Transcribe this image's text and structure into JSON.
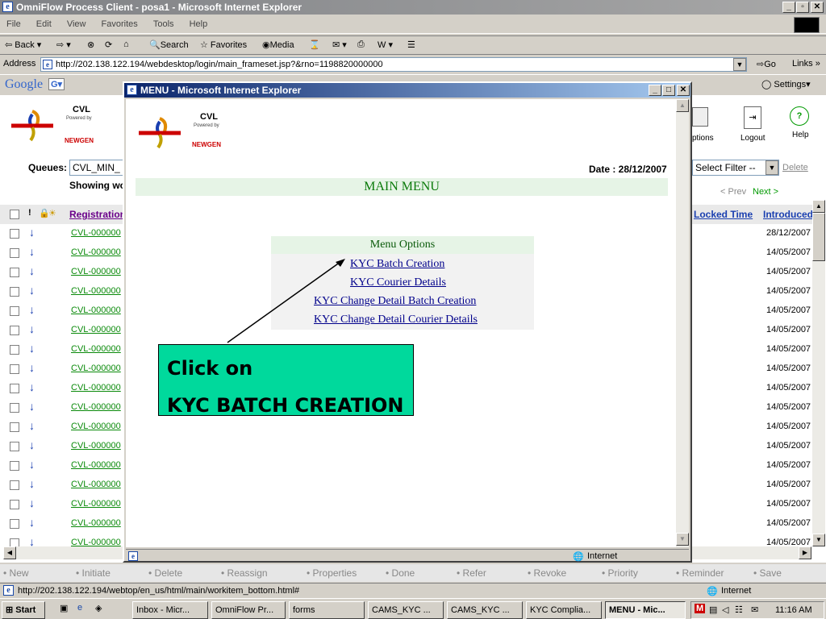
{
  "window": {
    "title": "OmniFlow Process Client - posa1 - Microsoft Internet Explorer"
  },
  "menubar": [
    "File",
    "Edit",
    "View",
    "Favorites",
    "Tools",
    "Help"
  ],
  "toolbar": {
    "back": "Back",
    "search": "Search",
    "favorites": "Favorites",
    "media": "Media"
  },
  "address": {
    "label": "Address",
    "url": "http://202.138.122.194/webdesktop/login/main_frameset.jsp?&rno=1198820000000",
    "go": "Go",
    "links": "Links"
  },
  "googlebar": {
    "logo": "Google",
    "settings": "Settings"
  },
  "app": {
    "logo_text": "CVL",
    "logo_powered": "Powered by",
    "logo_newgen": "NEWGEN",
    "queues_label": "Queues:",
    "queue_value": "CVL_MIN_",
    "showing": "Showing wo",
    "options_label": "ptions",
    "logout_label": "Logout",
    "help_label": "Help",
    "filter_value": "Select Filter --",
    "delete_link": "Delete",
    "prev": "< Prev",
    "next": "Next >",
    "columns": {
      "registration": "Registration",
      "locked_time": "Locked Time",
      "introduced": "Introduced"
    },
    "rows": [
      {
        "id": "CVL-000000",
        "date": "28/12/2007"
      },
      {
        "id": "CVL-000000",
        "date": "14/05/2007"
      },
      {
        "id": "CVL-000000",
        "date": "14/05/2007"
      },
      {
        "id": "CVL-000000",
        "date": "14/05/2007"
      },
      {
        "id": "CVL-000000",
        "date": "14/05/2007"
      },
      {
        "id": "CVL-000000",
        "date": "14/05/2007"
      },
      {
        "id": "CVL-000000",
        "date": "14/05/2007"
      },
      {
        "id": "CVL-000000",
        "date": "14/05/2007"
      },
      {
        "id": "CVL-000000",
        "date": "14/05/2007"
      },
      {
        "id": "CVL-000000",
        "date": "14/05/2007"
      },
      {
        "id": "CVL-000000",
        "date": "14/05/2007"
      },
      {
        "id": "CVL-000000",
        "date": "14/05/2007"
      },
      {
        "id": "CVL-000000",
        "date": "14/05/2007"
      },
      {
        "id": "CVL-000000",
        "date": "14/05/2007"
      },
      {
        "id": "CVL-000000",
        "date": "14/05/2007"
      },
      {
        "id": "CVL-000000",
        "date": "14/05/2007"
      },
      {
        "id": "CVL-000000",
        "date": "14/05/2007"
      }
    ],
    "bottom_actions": [
      "New",
      "Initiate",
      "Delete",
      "Reassign",
      "Properties",
      "Done",
      "Refer",
      "Revoke",
      "Priority",
      "Reminder",
      "Save"
    ]
  },
  "popup": {
    "title": "MENU - Microsoft Internet Explorer",
    "date": "Date : 28/12/2007",
    "main_menu": "MAIN MENU",
    "menu_options_header": "Menu Options",
    "links": [
      "KYC Batch Creation",
      "KYC Courier Details",
      "KYC Change Detail Batch Creation",
      "KYC Change Detail Courier Details"
    ],
    "status_zone": "Internet"
  },
  "callout": {
    "line1": "Click on",
    "line2": "KYC BATCH CREATION"
  },
  "statusbar": {
    "url": "http://202.138.122.194/webtop/en_us/html/main/workitem_bottom.html#",
    "zone": "Internet"
  },
  "taskbar": {
    "start": "Start",
    "tasks": [
      "Inbox - Micr...",
      "OmniFlow Pr...",
      "forms",
      "CAMS_KYC ...",
      "CAMS_KYC ...",
      "KYC Complia...",
      "MENU - Mic..."
    ],
    "clock": "11:16 AM"
  }
}
